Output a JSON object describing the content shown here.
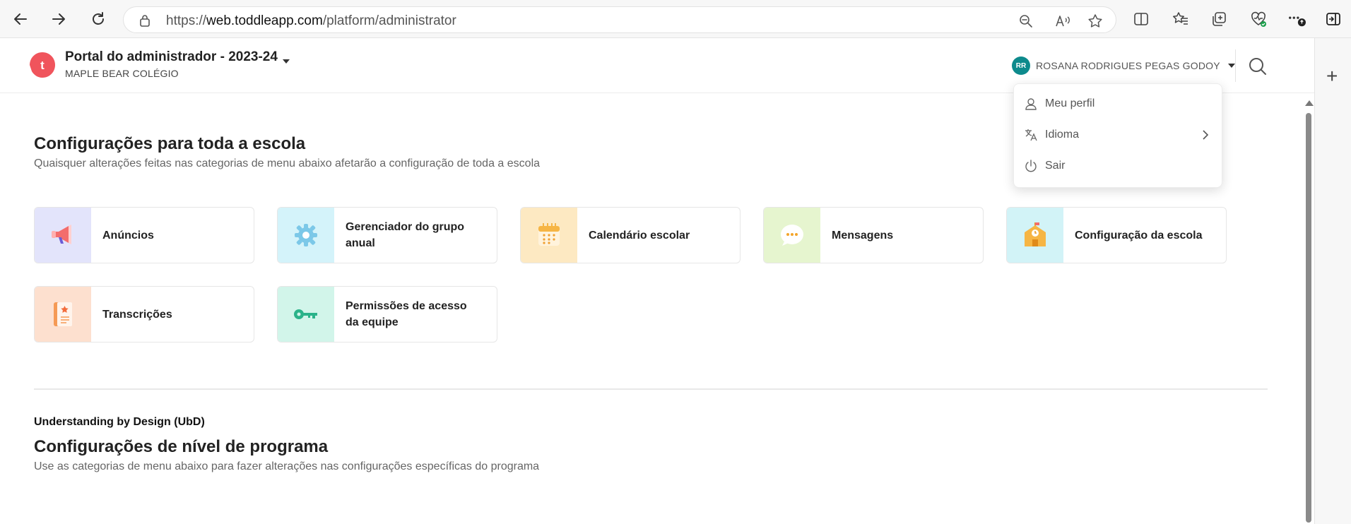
{
  "browser": {
    "url_prefix": "https://",
    "url_host": "web.toddleapp.com",
    "url_path": "/platform/administrator"
  },
  "header": {
    "logo_letter": "t",
    "portal_title": "Portal do administrador - 2023-24",
    "school_name": "MAPLE BEAR COLÉGIO",
    "user_initials": "RR",
    "user_name": "ROSANA RODRIGUES PEGAS GODOY"
  },
  "dropdown": {
    "items": [
      {
        "label": "Meu perfil",
        "icon": "person-icon"
      },
      {
        "label": "Idioma",
        "icon": "translate-icon"
      },
      {
        "label": "Sair",
        "icon": "power-icon"
      }
    ]
  },
  "school_settings": {
    "title": "Configurações para toda a escola",
    "subtitle": "Quaisquer alterações feitas nas categorias de menu abaixo afetarão a configuração de toda a escola",
    "cards": [
      {
        "label": "Anúncios",
        "icon": "megaphone-icon",
        "bg": "#e3e4fb"
      },
      {
        "label": "Gerenciador do grupo anual",
        "icon": "gear-icon",
        "bg": "#d4f3fa"
      },
      {
        "label": "Calendário escolar",
        "icon": "calendar-icon",
        "bg": "#fde9c2"
      },
      {
        "label": "Mensagens",
        "icon": "chat-bubble-icon",
        "bg": "#e6f5cf"
      },
      {
        "label": "Configuração da escola",
        "icon": "school-building-icon",
        "bg": "#d2f3f7"
      },
      {
        "label": "Transcrições",
        "icon": "transcript-book-icon",
        "bg": "#fde0cf"
      },
      {
        "label": "Permissões de acesso da equipe",
        "icon": "key-icon",
        "bg": "#d2f5ea"
      }
    ]
  },
  "program_settings": {
    "title": "Configurações de nível de programa",
    "subtitle": "Use as categorias de menu abaixo para fazer alterações nas configurações específicas do programa",
    "program_name": "Understanding by Design (UbD)"
  },
  "colors": {
    "logo": "#f0545c",
    "avatar": "#0d8a8c"
  }
}
